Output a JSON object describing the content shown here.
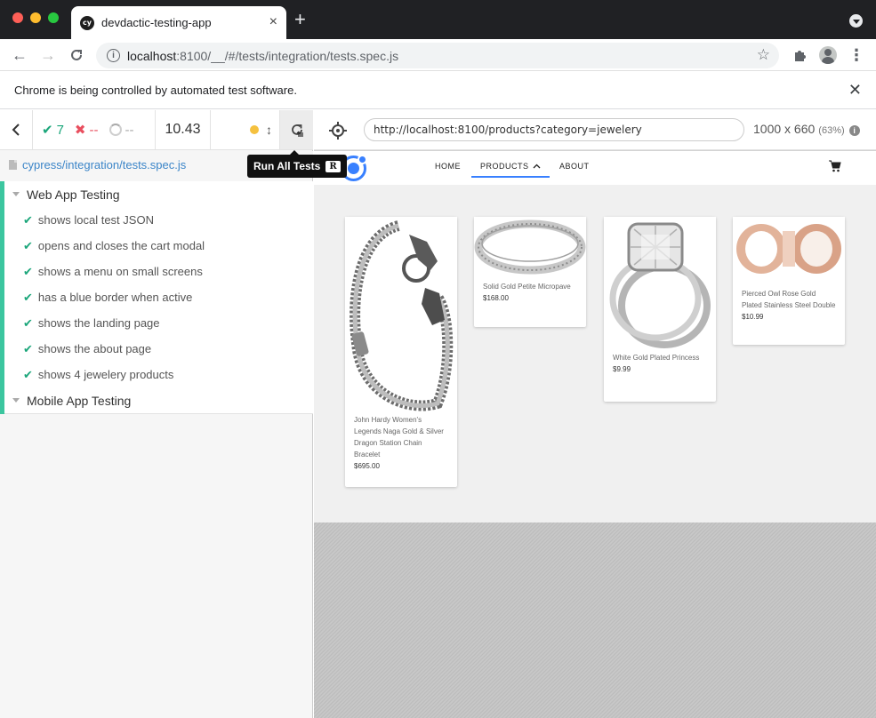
{
  "browser": {
    "tab_title": "devdactic-testing-app",
    "favicon_text": "cy",
    "url_host": "localhost",
    "url_rest": ":8100/__/#/tests/integration/tests.spec.js",
    "infobar_message": "Chrome is being controlled by automated test software."
  },
  "reporter": {
    "passed": "7",
    "failed": "--",
    "pending": "--",
    "duration": "10.43",
    "spec_path": "cypress/integration/tests.spec.js",
    "tooltip": "Run All Tests",
    "tooltip_key": "R",
    "suites": [
      {
        "title": "Web App Testing"
      },
      {
        "title": "Mobile App Testing"
      }
    ],
    "tests": [
      "shows local test JSON",
      "opens and closes the cart modal",
      "shows a menu on small screens",
      "has a blue border when active",
      "shows the landing page",
      "shows the about page",
      "shows 4 jewelery products"
    ]
  },
  "aut": {
    "url": "http://localhost:8100/products?category=jewelery",
    "viewport_size": "1000 x 660",
    "viewport_scale": "(63%)",
    "nav": {
      "home": "HOME",
      "products": "PRODUCTS",
      "about": "ABOUT"
    },
    "products": [
      {
        "name": "John Hardy Women's Legends Naga Gold & Silver Dragon Station Chain Bracelet",
        "price": "$695.00"
      },
      {
        "name": "Solid Gold Petite Micropave",
        "price": "$168.00"
      },
      {
        "name": "White Gold Plated Princess",
        "price": "$9.99"
      },
      {
        "name": "Pierced Owl Rose Gold Plated Stainless Steel Double",
        "price": "$10.99"
      }
    ]
  },
  "colors": {
    "pass": "#1ba67a",
    "fail": "#e94f5f",
    "suite_bar": "#3cc69f",
    "ionic_blue": "#3880ff"
  }
}
